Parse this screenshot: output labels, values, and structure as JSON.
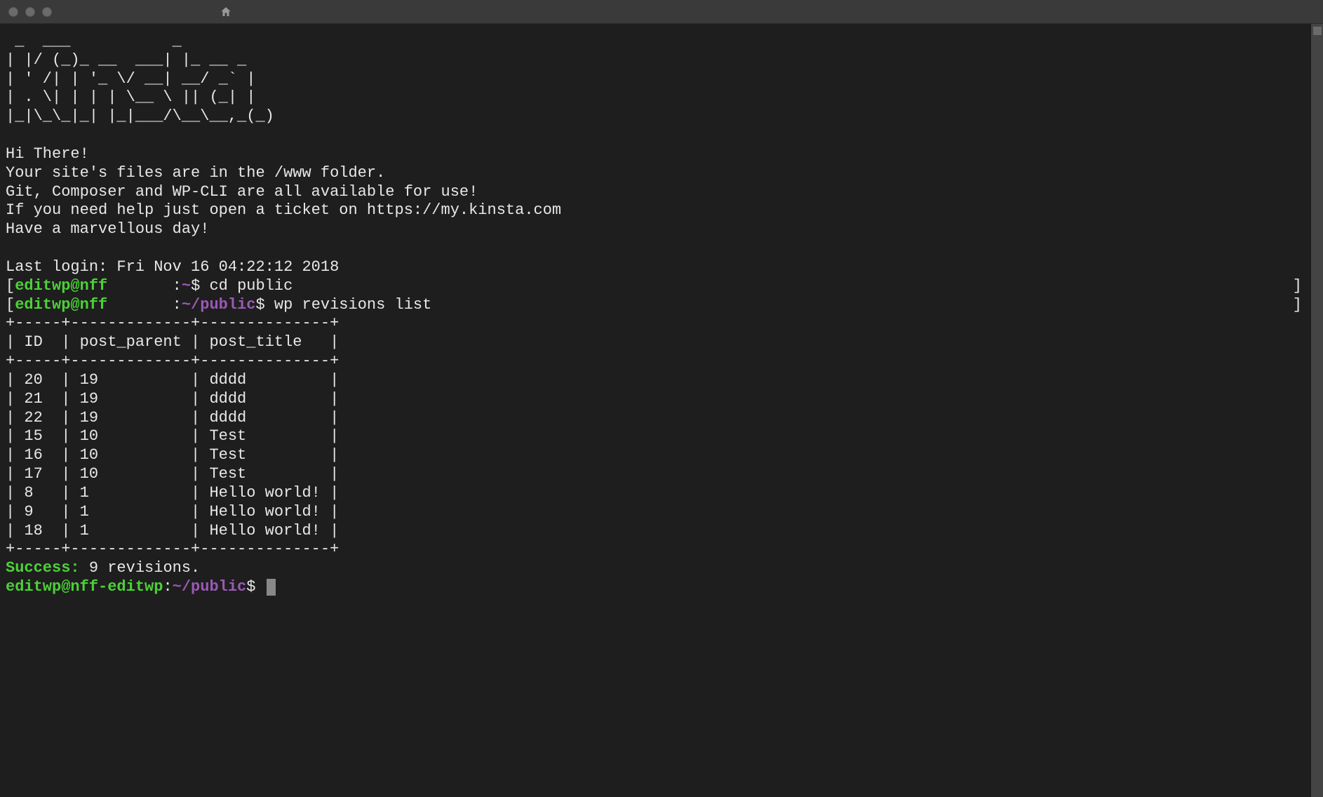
{
  "motd": {
    "ascii_art": " _  ___           _        \n| |/ (_)_ __  ___| |_ __ _ \n| ' /| | '_ \\/ __| __/ _` |\n| . \\| | | | \\__ \\ || (_| |\n|_|\\_\\_|_| |_|___/\\__\\__,_(_)",
    "greeting": "Hi There!",
    "line1": "Your site's files are in the /www folder.",
    "line2": "Git, Composer and WP-CLI are all available for use!",
    "line3": "If you need help just open a ticket on https://my.kinsta.com",
    "line4": "Have a marvellous day!",
    "last_login": "Last login: Fri Nov 16 04:22:12 2018"
  },
  "prompts": [
    {
      "bracket_open": "[",
      "user_host": "editwp@nff",
      "spacer": "       ",
      "colon": ":",
      "path": "~",
      "dollar": "$ ",
      "command": "cd public",
      "bracket_close": "]"
    },
    {
      "bracket_open": "[",
      "user_host": "editwp@nff",
      "spacer": "       ",
      "colon": ":",
      "path": "~/public",
      "dollar": "$ ",
      "command": "wp revisions list",
      "bracket_close": "]"
    }
  ],
  "table": {
    "border_top": "+-----+-------------+--------------+",
    "header": "| ID  | post_parent | post_title   |",
    "border_mid": "+-----+-------------+--------------+",
    "rows": [
      "| 20  | 19          | dddd         |",
      "| 21  | 19          | dddd         |",
      "| 22  | 19          | dddd         |",
      "| 15  | 10          | Test         |",
      "| 16  | 10          | Test         |",
      "| 17  | 10          | Test         |",
      "| 8   | 1           | Hello world! |",
      "| 9   | 1           | Hello world! |",
      "| 18  | 1           | Hello world! |"
    ],
    "border_bot": "+-----+-------------+--------------+"
  },
  "success": {
    "label": "Success:",
    "message": " 9 revisions."
  },
  "final_prompt": {
    "user_host": "editwp@nff-editwp",
    "colon": ":",
    "path": "~/public",
    "dollar": "$ "
  },
  "chart_data": {
    "type": "table",
    "title": "wp revisions list",
    "columns": [
      "ID",
      "post_parent",
      "post_title"
    ],
    "rows": [
      {
        "ID": 20,
        "post_parent": 19,
        "post_title": "dddd"
      },
      {
        "ID": 21,
        "post_parent": 19,
        "post_title": "dddd"
      },
      {
        "ID": 22,
        "post_parent": 19,
        "post_title": "dddd"
      },
      {
        "ID": 15,
        "post_parent": 10,
        "post_title": "Test"
      },
      {
        "ID": 16,
        "post_parent": 10,
        "post_title": "Test"
      },
      {
        "ID": 17,
        "post_parent": 10,
        "post_title": "Test"
      },
      {
        "ID": 8,
        "post_parent": 1,
        "post_title": "Hello world!"
      },
      {
        "ID": 9,
        "post_parent": 1,
        "post_title": "Hello world!"
      },
      {
        "ID": 18,
        "post_parent": 1,
        "post_title": "Hello world!"
      }
    ],
    "summary": "9 revisions."
  }
}
